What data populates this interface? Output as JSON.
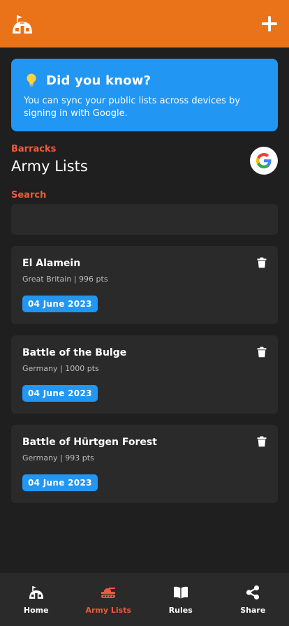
{
  "header": {
    "logo_icon": "barracks-hut-icon",
    "add_icon": "plus-icon",
    "brand_color": "#ea7218"
  },
  "tip": {
    "icon": "lightbulb-icon",
    "title": "Did you know?",
    "text": "You can sync your public lists across devices by signing in with Google.",
    "color": "#2196f3"
  },
  "section": {
    "label": "Barracks",
    "title": "Army Lists",
    "accent": "#ef5a3c"
  },
  "google": {
    "icon": "google-icon"
  },
  "search": {
    "label": "Search",
    "value": "",
    "placeholder": ""
  },
  "armies": [
    {
      "name": "El Alamein",
      "meta": "Great Britain | 996 pts",
      "date": "04 June 2023"
    },
    {
      "name": "Battle of the Bulge",
      "meta": "Germany | 1000 pts",
      "date": "04 June 2023"
    },
    {
      "name": "Battle of Hürtgen Forest",
      "meta": "Germany | 993 pts",
      "date": "04 June 2023"
    }
  ],
  "nav": [
    {
      "label": "Home",
      "icon": "home-icon",
      "active": false
    },
    {
      "label": "Army Lists",
      "icon": "tank-icon",
      "active": true
    },
    {
      "label": "Rules",
      "icon": "book-icon",
      "active": false
    },
    {
      "label": "Share",
      "icon": "share-icon",
      "active": false
    }
  ]
}
